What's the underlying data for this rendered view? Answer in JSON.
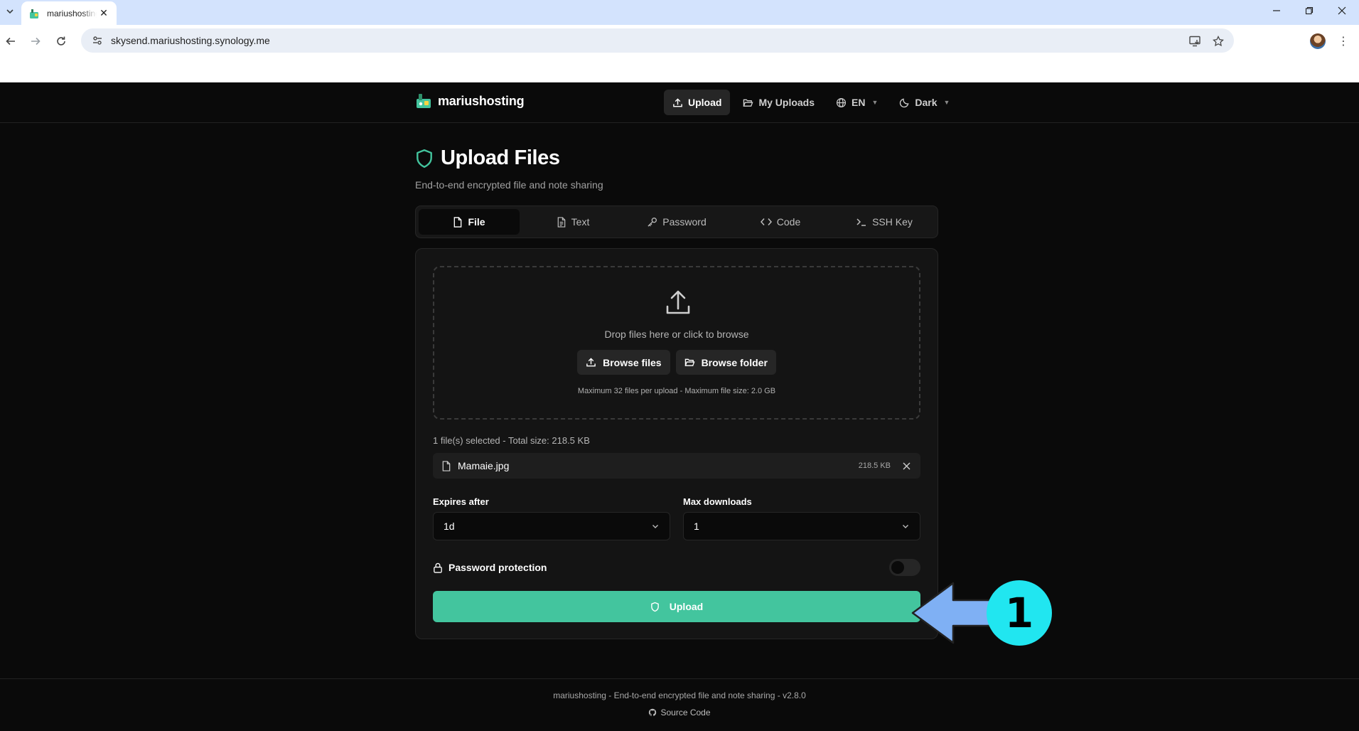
{
  "browser": {
    "tab_title": "mariushosting",
    "url": "skysend.mariushosting.synology.me"
  },
  "header": {
    "brand": "mariushosting",
    "nav": {
      "upload": "Upload",
      "my_uploads": "My Uploads",
      "language": "EN",
      "theme": "Dark"
    }
  },
  "main": {
    "title": "Upload Files",
    "subtitle": "End-to-end encrypted file and note sharing",
    "tabs": [
      {
        "label": "File",
        "icon": "file-icon",
        "active": true
      },
      {
        "label": "Text",
        "icon": "file-text-icon",
        "active": false
      },
      {
        "label": "Password",
        "icon": "key-icon",
        "active": false
      },
      {
        "label": "Code",
        "icon": "code-icon",
        "active": false
      },
      {
        "label": "SSH Key",
        "icon": "terminal-icon",
        "active": false
      }
    ],
    "dropzone": {
      "prompt": "Drop files here or click to browse",
      "browse_files": "Browse files",
      "browse_folder": "Browse folder",
      "limits": "Maximum 32 files per upload - Maximum file size: 2.0 GB"
    },
    "selection": {
      "summary": "1 file(s) selected - Total size: 218.5 KB",
      "files": [
        {
          "name": "Mamaie.jpg",
          "size": "218.5 KB"
        }
      ]
    },
    "expires": {
      "label": "Expires after",
      "value": "1d"
    },
    "max_downloads": {
      "label": "Max downloads",
      "value": "1"
    },
    "password_protection": {
      "label": "Password protection",
      "enabled": false
    },
    "upload_button": "Upload"
  },
  "footer": {
    "text": "mariushosting - End-to-end encrypted file and note sharing - v2.8.0",
    "source_code": "Source Code"
  },
  "annotation": {
    "step": "1",
    "arrow_color": "#7fb0f4",
    "circle_color": "#21e6f0"
  },
  "colors": {
    "accent": "#43c59e",
    "background": "#0a0a0a",
    "card": "#141414"
  }
}
